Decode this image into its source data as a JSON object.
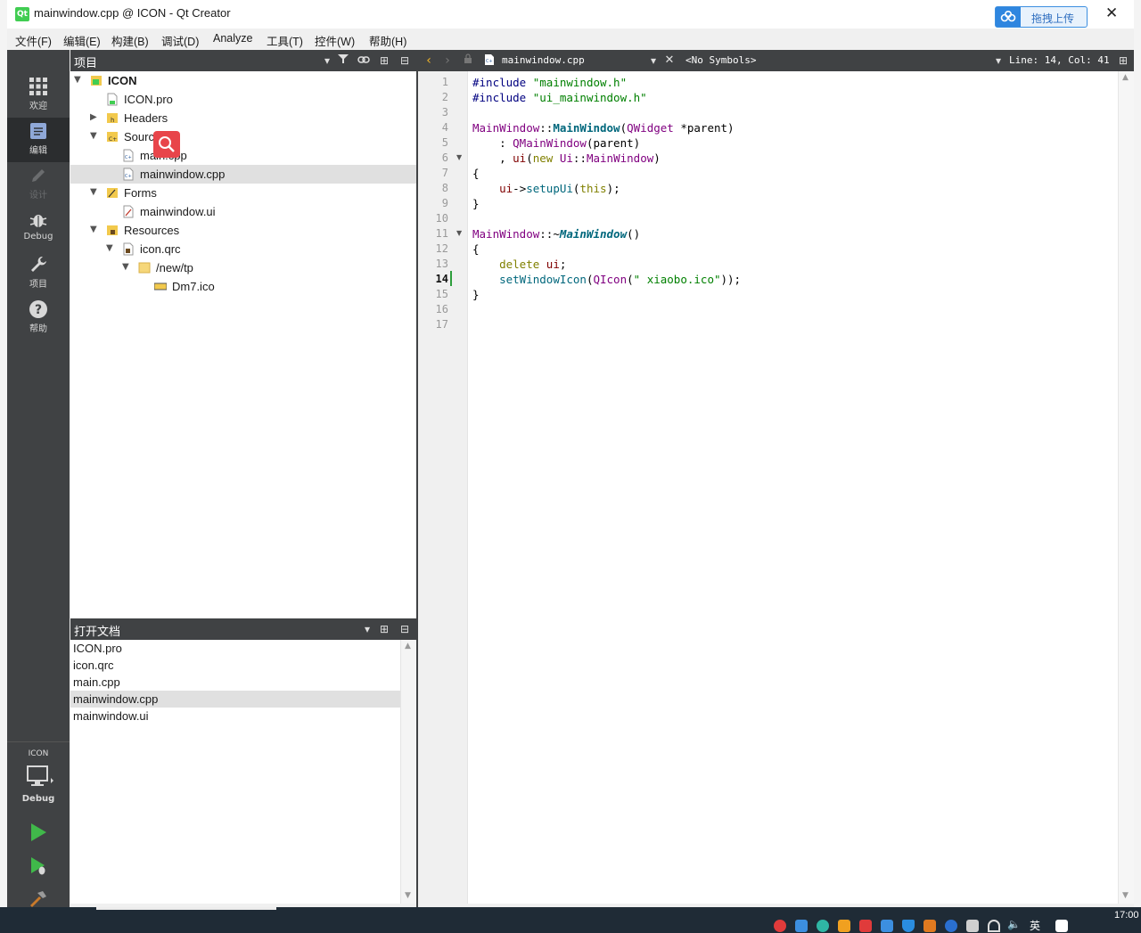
{
  "window": {
    "title": "mainwindow.cpp @ ICON - Qt Creator",
    "logo_text": "Qt",
    "upload_button": "拖拽上传",
    "close_glyph": "✕"
  },
  "menu": [
    "文件(F)",
    "编辑(E)",
    "构建(B)",
    "调试(D)",
    "Analyze",
    "工具(T)",
    "控件(W)",
    "帮助(H)"
  ],
  "modes": [
    {
      "label": "欢迎",
      "icon": "grid-icon"
    },
    {
      "label": "编辑",
      "icon": "document-icon",
      "active": true
    },
    {
      "label": "设计",
      "icon": "pencil-icon",
      "disabled": true
    },
    {
      "label": "Debug",
      "icon": "bug-icon"
    },
    {
      "label": "项目",
      "icon": "wrench-icon"
    },
    {
      "label": "帮助",
      "icon": "help-icon"
    }
  ],
  "kit": {
    "project": "ICON",
    "build": "Debug"
  },
  "project_pane": {
    "title": "项目",
    "tree": [
      {
        "label": "ICON",
        "icon": "project-icon"
      },
      {
        "label": "ICON.pro",
        "icon": "pro-file-icon"
      },
      {
        "label": "Headers",
        "icon": "headers-folder-icon"
      },
      {
        "label": "Sources",
        "icon": "sources-folder-icon"
      },
      {
        "label": "main.cpp",
        "icon": "cpp-file-icon"
      },
      {
        "label": "mainwindow.cpp",
        "icon": "cpp-file-icon",
        "selected": true
      },
      {
        "label": "Forms",
        "icon": "forms-folder-icon"
      },
      {
        "label": "mainwindow.ui",
        "icon": "ui-file-icon"
      },
      {
        "label": "Resources",
        "icon": "resources-folder-icon"
      },
      {
        "label": "icon.qrc",
        "icon": "qrc-file-icon"
      },
      {
        "label": "/new/tp",
        "icon": "folder-icon"
      },
      {
        "label": "Dm7.ico",
        "icon": "image-file-icon"
      }
    ]
  },
  "open_documents": {
    "title": "打开文档",
    "items": [
      "ICON.pro",
      "icon.qrc",
      "main.cpp",
      "mainwindow.cpp",
      "mainwindow.ui"
    ],
    "selected": "mainwindow.cpp"
  },
  "editor": {
    "file": "mainwindow.cpp",
    "symbols": "<No Symbols>",
    "position": "Line: 14, Col: 41",
    "current_line": 14,
    "line_numbers": [
      "1",
      "2",
      "3",
      "4",
      "5",
      "6",
      "7",
      "8",
      "9",
      "10",
      "11",
      "12",
      "13",
      "14",
      "15",
      "16",
      "17"
    ]
  },
  "taskbar": {
    "time": "17:00",
    "ime": "英"
  },
  "colors": {
    "sidebar": "#404244",
    "sidebar_active": "#2b2d2f",
    "selection": "#e0e0e0",
    "qt_green": "#41cd52",
    "string": "#008000",
    "type": "#800080",
    "keyword": "#808000"
  }
}
